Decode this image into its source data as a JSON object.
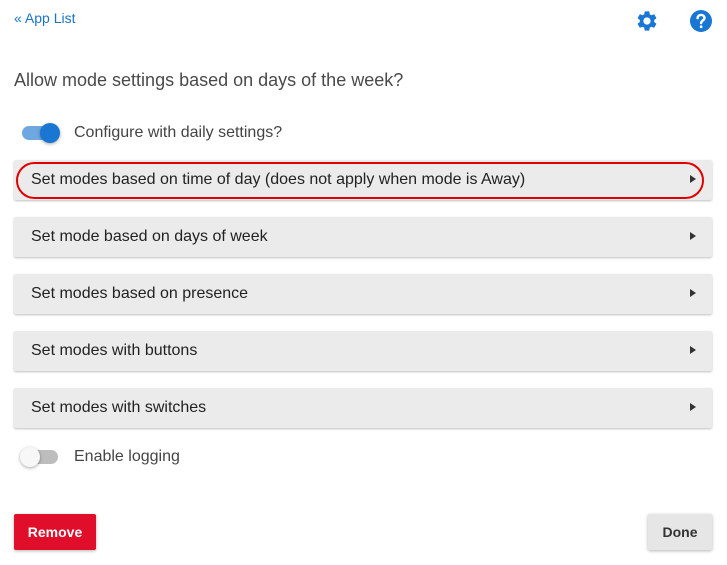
{
  "nav": {
    "back_label": "« App List"
  },
  "icons": {
    "settings": "gear-icon",
    "help": "help-icon",
    "accent_color": "#1976d2"
  },
  "question": "Allow mode settings based on days of the week?",
  "daily_toggle": {
    "label": "Configure with daily settings?",
    "state": "on"
  },
  "sections": [
    {
      "label": "Set modes based on time of day (does not apply when mode is Away)",
      "highlighted": true
    },
    {
      "label": "Set mode based on days of week"
    },
    {
      "label": "Set modes based on presence"
    },
    {
      "label": "Set modes with buttons"
    },
    {
      "label": "Set modes with switches"
    }
  ],
  "logging_toggle": {
    "label": "Enable logging",
    "state": "off"
  },
  "buttons": {
    "remove_label": "Remove",
    "remove_color": "#e00e2a",
    "done_label": "Done"
  }
}
